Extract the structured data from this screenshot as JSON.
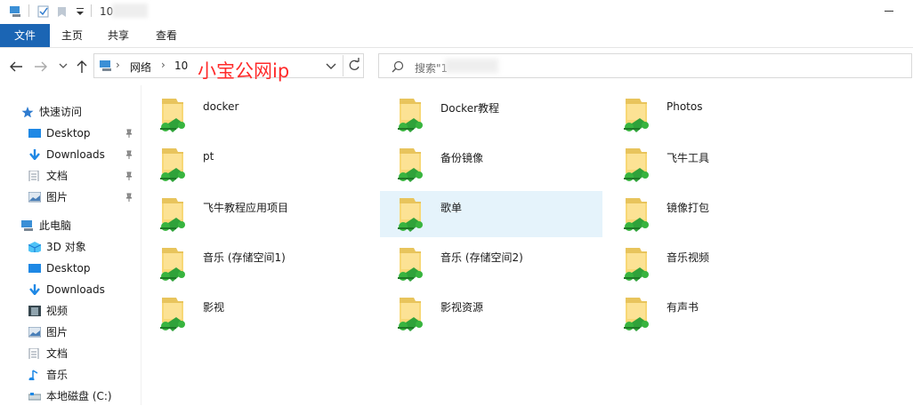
{
  "titlebar": {
    "title_prefix": "10"
  },
  "ribbon": {
    "tabs": [
      "文件",
      "主页",
      "共享",
      "查看"
    ]
  },
  "address": {
    "crumbs": [
      "网络",
      "10"
    ],
    "overlay_text": "小宝公网ip"
  },
  "search": {
    "placeholder": "搜索\"1"
  },
  "sidebar": {
    "quick_access": "快速访问",
    "quick_items": [
      "Desktop",
      "Downloads",
      "文档",
      "图片"
    ],
    "this_pc": "此电脑",
    "pc_items": [
      "3D 对象",
      "Desktop",
      "Downloads",
      "视频",
      "图片",
      "文档",
      "音乐",
      "本地磁盘 (C:)"
    ]
  },
  "folders": [
    "docker",
    "Docker教程",
    "Photos",
    "pt",
    "备份镜像",
    "飞牛工具",
    "飞牛教程应用项目",
    "歌单",
    "镜像打包",
    "音乐 (存储空间1)",
    "音乐 (存储空间2)",
    "音乐视频",
    "影视",
    "影视资源",
    "有声书"
  ],
  "selected_folder": "歌单",
  "colors": {
    "accent": "#1b65b4",
    "selection": "#e5f3fb",
    "overlay": "#ff2a2a"
  }
}
